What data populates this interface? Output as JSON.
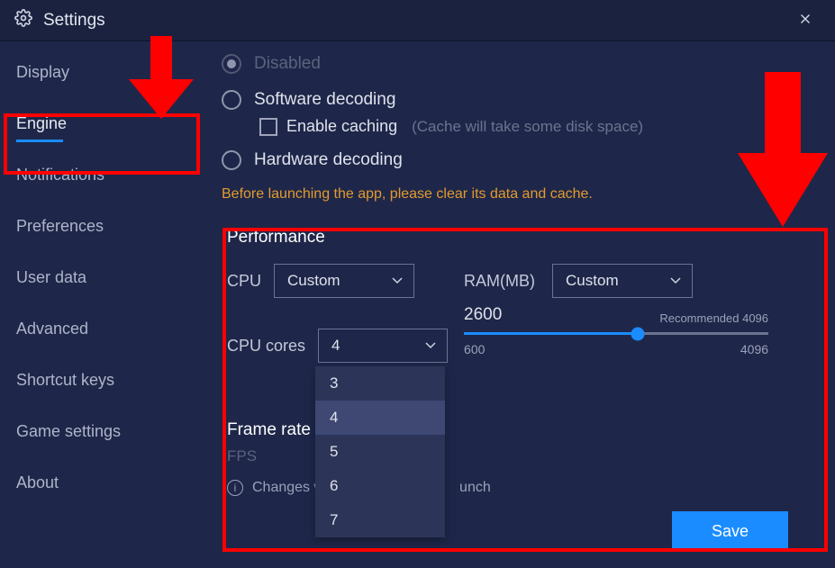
{
  "titlebar": {
    "title": "Settings"
  },
  "sidebar": {
    "items": [
      {
        "label": "Display"
      },
      {
        "label": "Engine"
      },
      {
        "label": "Notifications"
      },
      {
        "label": "Preferences"
      },
      {
        "label": "User data"
      },
      {
        "label": "Advanced"
      },
      {
        "label": "Shortcut keys"
      },
      {
        "label": "Game settings"
      },
      {
        "label": "About"
      }
    ],
    "active_index": 1
  },
  "decoding": {
    "disabled_label": "Disabled",
    "software_label": "Software decoding",
    "enable_caching_label": "Enable caching",
    "enable_caching_hint": "(Cache will take some disk space)",
    "hardware_label": "Hardware decoding",
    "warning": "Before launching the app, please clear its data and cache."
  },
  "performance": {
    "title": "Performance",
    "cpu_label": "CPU",
    "cpu_value": "Custom",
    "cpu_cores_label": "CPU cores",
    "cpu_cores_value": "4",
    "cpu_cores_options": [
      "3",
      "4",
      "5",
      "6",
      "7"
    ],
    "ram_label": "RAM(MB)",
    "ram_select": "Custom",
    "ram_value": "2600",
    "ram_recommended": "Recommended 4096",
    "ram_min": "600",
    "ram_max": "4096",
    "ram_fill_pct": 57,
    "frame_rate_title": "Frame rate",
    "fps_label": "FPS",
    "changes_note_prefix": "Changes w",
    "changes_note_suffix": "unch",
    "save": "Save"
  }
}
